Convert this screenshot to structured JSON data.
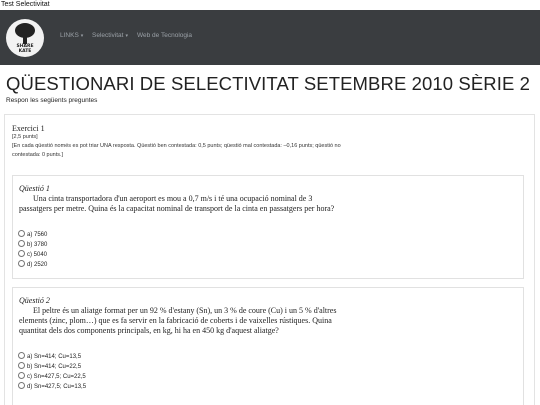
{
  "window_title": "Test Selectivitat",
  "logo_text": "SHARE\nKATE",
  "nav": {
    "links_label": "LINKS",
    "selectivitat_label": "Selectivitat",
    "web_label": "Web de Tecnologia"
  },
  "page": {
    "title": "QÜESTIONARI DE SELECTIVITAT SETEMBRE 2010 SÈRIE 2",
    "subtitle": "Respon les següents preguntes"
  },
  "exercise": {
    "title": "Exercici 1",
    "points": "[2,5 punts]",
    "instructions": "[En cada qüestió només es pot triar UNA resposta. Qüestió ben contestada: 0,5 punts; qüestió mal contestada: –0,16 punts; qüestió no contestada: 0 punts.]"
  },
  "questions": [
    {
      "title": "Qüestió 1",
      "text": "Una cinta transportadora d'un aeroport es mou a 0,7 m/s i té una ocupació nominal de 3 passatgers per metre. Quina és la capacitat nominal de transport de la cinta en passatgers per hora?",
      "options": [
        "a) 7560",
        "b) 3780",
        "c) 5040",
        "d) 2520"
      ]
    },
    {
      "title": "Qüestió 2",
      "text": "El peltre és un aliatge format per un 92 % d'estany (Sn), un 3 % de coure (Cu) i un 5 % d'altres elements (zinc, plom…) que es fa servir en la fabricació de coberts i de vaixelles rústiques. Quina quantitat dels dos components principals, en kg, hi ha en 450 kg d'aquest aliatge?",
      "options": [
        "a) Sn=414; Cu=13,5",
        "b) Sn=414; Cu=22,5",
        "c) Sn=427,5; Cu=22,5",
        "d) Sn=427,5; Cu=13,5"
      ]
    }
  ],
  "colors": {
    "navbar": "#3a3d40",
    "nav_link": "#9aa0a6",
    "panel_border": "#e3e3e3"
  }
}
